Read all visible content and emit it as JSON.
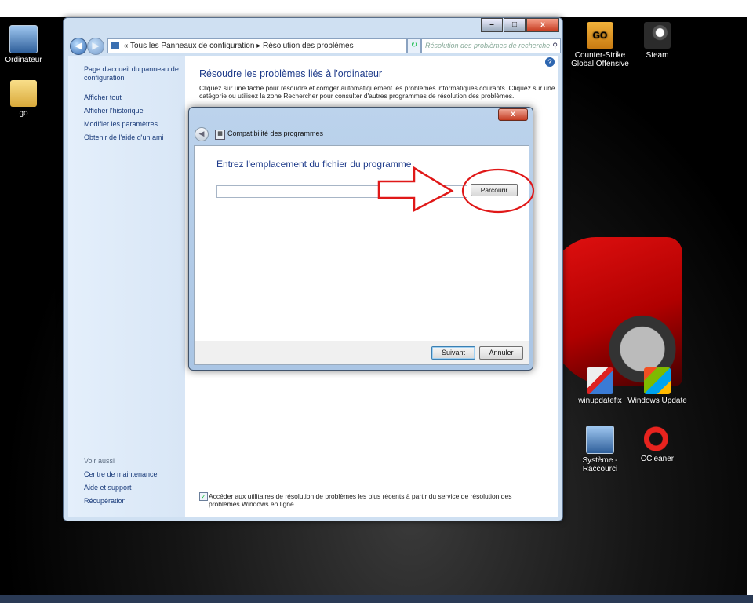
{
  "desktop": {
    "icons": [
      {
        "label": "Ordinateur"
      },
      {
        "label": "go"
      },
      {
        "label": "Counter-Strike Global Offensive",
        "badge": "GO"
      },
      {
        "label": "Steam"
      },
      {
        "label": "winupdatefix"
      },
      {
        "label": "Windows Update"
      },
      {
        "label": "Système - Raccourci"
      },
      {
        "label": "CCleaner"
      }
    ]
  },
  "window": {
    "controls": {
      "minimize": "–",
      "maximize": "□",
      "close": "x"
    },
    "address": {
      "prefix": "«",
      "crumb_1": "Tous les Panneaux de configuration",
      "separator": "▸",
      "crumb_2": "Résolution des problèmes"
    },
    "search_placeholder": "Résolution des problèmes de recherche",
    "left_pane": {
      "home": "Page d'accueil du panneau de configuration",
      "links": [
        "Afficher tout",
        "Afficher l'historique",
        "Modifier les paramètres",
        "Obtenir de l'aide d'un ami"
      ],
      "see_also_title": "Voir aussi",
      "see_also": [
        "Centre de maintenance",
        "Aide et support",
        "Récupération"
      ]
    },
    "main": {
      "heading": "Résoudre les problèmes liés à l'ordinateur",
      "description": "Cliquez sur une tâche pour résoudre et corriger automatiquement les problèmes informatiques courants. Cliquez sur une catégorie ou utilisez la zone Rechercher pour consulter d'autres programmes de résolution des problèmes.",
      "online_checkbox": {
        "checked": true,
        "label": "Accéder aux utilitaires de résolution de problèmes les plus récents à partir du service de résolution des problèmes Windows en ligne"
      }
    }
  },
  "dialog": {
    "close": "x",
    "title": "Compatibilité des programmes",
    "question": "Entrez l'emplacement du fichier du programme",
    "input_value": "",
    "browse_label": "Parcourir",
    "next_label": "Suivant",
    "cancel_label": "Annuler"
  },
  "annotation": {
    "color": "#e01818"
  },
  "colors": {
    "accent": "#1e3b8a",
    "link": "#1a3b7a",
    "annotation_red": "#e01818"
  }
}
